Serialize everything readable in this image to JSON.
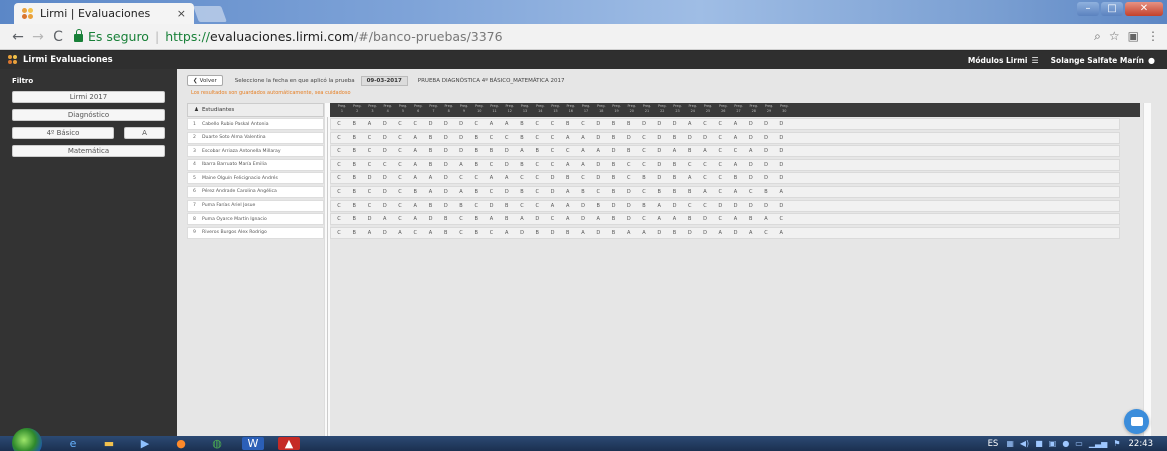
{
  "browser": {
    "tab_title": "Lirmi | Evaluaciones",
    "tab_close": "×",
    "secure_label": "Es seguro",
    "url_scheme": "https://",
    "url_host": "evaluaciones.lirmi.com",
    "url_path": "/#/banco-pruebas/3376",
    "win_min": "–",
    "win_max": "□",
    "win_close": "✕"
  },
  "app": {
    "title": "Lirmi Evaluaciones",
    "modules_label": "Módulos Lirmi",
    "modules_icon": "grid-icon",
    "user_name": "Solange Salfate Marín",
    "user_icon": "user-icon"
  },
  "sidebar": {
    "filter_title": "Filtro",
    "year": "Lirmi 2017",
    "type": "Diagnóstico",
    "grade": "4º Básico",
    "section": "A",
    "subject": "Matemática"
  },
  "toolbar": {
    "back_label": "Volver",
    "back_icon": "chevron-left-icon",
    "date_prompt": "Seleccione la fecha en que aplicó la prueba",
    "date_value": "09-03-2017",
    "test_name": "PRUEBA DIAGNÓSTICA 4º BÁSICO_MATEMÁTICA 2017",
    "autosave_warning": "Los resultados son guardados automáticamente, sea cuidadoso"
  },
  "table": {
    "students_header": "Estudiantes",
    "question_prefix": "Preg.",
    "question_numbers": [
      "1",
      "2",
      "3",
      "4",
      "5",
      "6",
      "7",
      "8",
      "9",
      "10",
      "11",
      "12",
      "13",
      "14",
      "15",
      "16",
      "17",
      "18",
      "19",
      "20",
      "21",
      "22",
      "23",
      "24",
      "25",
      "26",
      "27",
      "28",
      "29",
      "30"
    ],
    "students": [
      {
        "num": "1",
        "name": "Cabello Rubio Paskal Antonia",
        "answers": [
          "C",
          "B",
          "A",
          "D",
          "C",
          "C",
          "D",
          "D",
          "D",
          "C",
          "A",
          "A",
          "B",
          "C",
          "C",
          "B",
          "C",
          "D",
          "B",
          "B",
          "D",
          "D",
          "D",
          "A",
          "C",
          "C",
          "A",
          "D",
          "D",
          "D"
        ]
      },
      {
        "num": "2",
        "name": "Duarte Soto Alma Valentina",
        "answers": [
          "C",
          "B",
          "C",
          "D",
          "C",
          "A",
          "B",
          "D",
          "D",
          "B",
          "C",
          "C",
          "B",
          "C",
          "C",
          "A",
          "A",
          "D",
          "B",
          "D",
          "C",
          "D",
          "B",
          "D",
          "D",
          "C",
          "A",
          "D",
          "D",
          "D"
        ]
      },
      {
        "num": "3",
        "name": "Escobar Arriaza Antonella Millaray",
        "answers": [
          "C",
          "B",
          "C",
          "D",
          "C",
          "A",
          "B",
          "D",
          "D",
          "B",
          "B",
          "D",
          "A",
          "B",
          "C",
          "C",
          "A",
          "A",
          "D",
          "B",
          "C",
          "D",
          "A",
          "B",
          "A",
          "C",
          "C",
          "A",
          "D",
          "D"
        ]
      },
      {
        "num": "4",
        "name": "Ibarra Barruato María Emilia",
        "answers": [
          "C",
          "B",
          "C",
          "C",
          "C",
          "A",
          "B",
          "D",
          "A",
          "B",
          "C",
          "D",
          "B",
          "C",
          "C",
          "A",
          "A",
          "D",
          "B",
          "C",
          "C",
          "D",
          "B",
          "C",
          "C",
          "C",
          "A",
          "D",
          "D",
          "D"
        ]
      },
      {
        "num": "5",
        "name": "Maine Olguín Felicignacio Andrés",
        "answers": [
          "C",
          "B",
          "D",
          "D",
          "C",
          "A",
          "A",
          "D",
          "C",
          "C",
          "A",
          "A",
          "C",
          "C",
          "D",
          "B",
          "C",
          "D",
          "B",
          "C",
          "B",
          "D",
          "B",
          "A",
          "C",
          "C",
          "B",
          "D",
          "D",
          "D"
        ]
      },
      {
        "num": "6",
        "name": "Pérez Andrade Carolina Angélica",
        "answers": [
          "C",
          "B",
          "C",
          "D",
          "C",
          "B",
          "A",
          "D",
          "A",
          "B",
          "C",
          "D",
          "B",
          "C",
          "D",
          "A",
          "B",
          "C",
          "B",
          "D",
          "C",
          "B",
          "B",
          "B",
          "A",
          "C",
          "A",
          "C",
          "B",
          "A"
        ]
      },
      {
        "num": "7",
        "name": "Puma Farías Ariel Josue",
        "answers": [
          "C",
          "B",
          "C",
          "D",
          "C",
          "A",
          "B",
          "D",
          "B",
          "C",
          "D",
          "B",
          "C",
          "C",
          "A",
          "A",
          "D",
          "B",
          "D",
          "D",
          "B",
          "A",
          "D",
          "C",
          "C",
          "D",
          "D",
          "D",
          "D",
          "D"
        ]
      },
      {
        "num": "8",
        "name": "Puma Oyarce Martín Ignacio",
        "answers": [
          "C",
          "B",
          "D",
          "A",
          "C",
          "A",
          "D",
          "B",
          "C",
          "B",
          "A",
          "B",
          "A",
          "D",
          "C",
          "A",
          "D",
          "A",
          "B",
          "D",
          "C",
          "A",
          "A",
          "B",
          "D",
          "C",
          "A",
          "B",
          "A",
          "C"
        ]
      },
      {
        "num": "9",
        "name": "Riveros Burgos Alex Rodrigo",
        "answers": [
          "C",
          "B",
          "A",
          "D",
          "A",
          "C",
          "A",
          "B",
          "C",
          "B",
          "C",
          "A",
          "D",
          "B",
          "D",
          "B",
          "A",
          "D",
          "B",
          "A",
          "A",
          "D",
          "B",
          "D",
          "D",
          "A",
          "D",
          "A",
          "C",
          "A"
        ]
      }
    ]
  },
  "taskbar": {
    "language": "ES",
    "clock": "22:43"
  }
}
